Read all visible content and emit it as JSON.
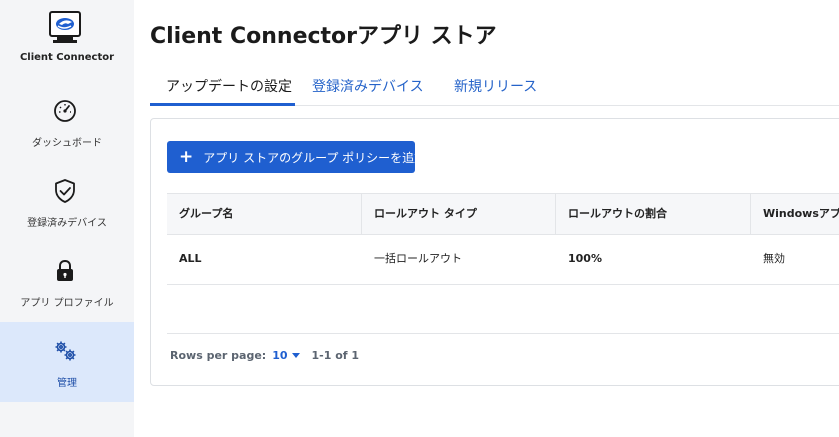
{
  "sidebar": {
    "brand_label": "Client Connector",
    "items": [
      {
        "label": "ダッシュボード",
        "icon": "dashboard-gauge-icon"
      },
      {
        "label": "登録済みデバイス",
        "icon": "shield-check-icon"
      },
      {
        "label": "アプリ プロファイル",
        "icon": "lock-icon"
      },
      {
        "label": "管理",
        "icon": "gears-icon",
        "active": true
      }
    ]
  },
  "page": {
    "title": "Client Connectorアプリ ストア"
  },
  "tabs": [
    {
      "label": "アップデートの設定",
      "active": true
    },
    {
      "label": "登録済みデバイス"
    },
    {
      "label": "新規リリース"
    }
  ],
  "actions": {
    "add_policy_label": "アプリ ストアのグループ ポリシーを追加"
  },
  "table": {
    "columns": [
      "グループ名",
      "ロールアウト タイプ",
      "ロールアウトの割合",
      "Windowsアプ"
    ],
    "rows": [
      [
        "ALL",
        "一括ロールアウト",
        "100%",
        "無効"
      ]
    ]
  },
  "pagination": {
    "rows_per_page_label": "Rows per page:",
    "rows_per_page_value": "10",
    "range": "1-1 of 1"
  },
  "colors": {
    "accent": "#1f5fd0",
    "sidebar_bg": "#f4f5f7",
    "active_nav_bg": "#dce8fb"
  }
}
